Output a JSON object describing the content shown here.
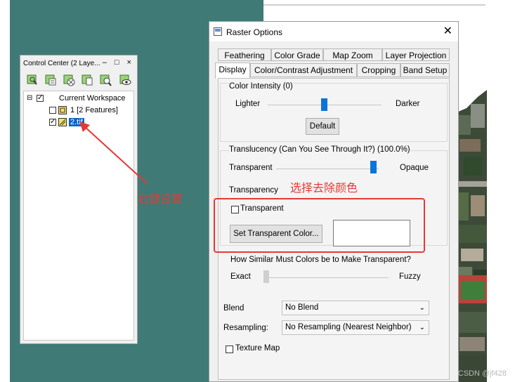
{
  "control_center": {
    "title": "Control Center (2 Laye...",
    "window_buttons": "– □ ×",
    "toolbar_icons": [
      "add-layer-icon",
      "layer-list-icon",
      "remove-layer-icon",
      "layer-props-icon",
      "zoom-layer-icon",
      "view-layer-icon"
    ],
    "tree": {
      "collapse": "⊟",
      "workspace": "Current Workspace",
      "layer1": "1 [2 Features]",
      "layer2": "2.tif"
    }
  },
  "annotations": {
    "right_click_note": "右键设置",
    "select_remove_note": "选择去除颜色",
    "watermark": "CSDN @jf428"
  },
  "dialog": {
    "title": "Raster Options",
    "close": "✕",
    "tabs_row1": [
      "Feathering",
      "Color Grade",
      "Map Zoom",
      "Layer Projection"
    ],
    "tabs_row2": [
      "Display",
      "Color/Contrast Adjustment",
      "Cropping",
      "Band Setup"
    ],
    "color_intensity": {
      "label": "Color Intensity (0)",
      "left": "Lighter",
      "right": "Darker",
      "value_fraction": 0.5
    },
    "default_button": "Default",
    "translucency": {
      "label": "Translucency (Can You See Through It?) (100.0%)",
      "left": "Transparent",
      "right": "Opaque",
      "value_fraction": 1.0
    },
    "transparency": {
      "label": "Transparency",
      "checkbox_label": "Transparent",
      "checked": false,
      "set_color_button": "Set Transparent Color...",
      "similarity_label": "How Similar Must Colors be to Make Transparent?",
      "left": "Exact",
      "right": "Fuzzy",
      "value_fraction": 0.0
    },
    "blend": {
      "label": "Blend",
      "value": "No Blend"
    },
    "resampling": {
      "label": "Resampling:",
      "value": "No Resampling (Nearest Neighbor)"
    },
    "texture_map": {
      "label": "Texture Map",
      "checked": false
    }
  }
}
